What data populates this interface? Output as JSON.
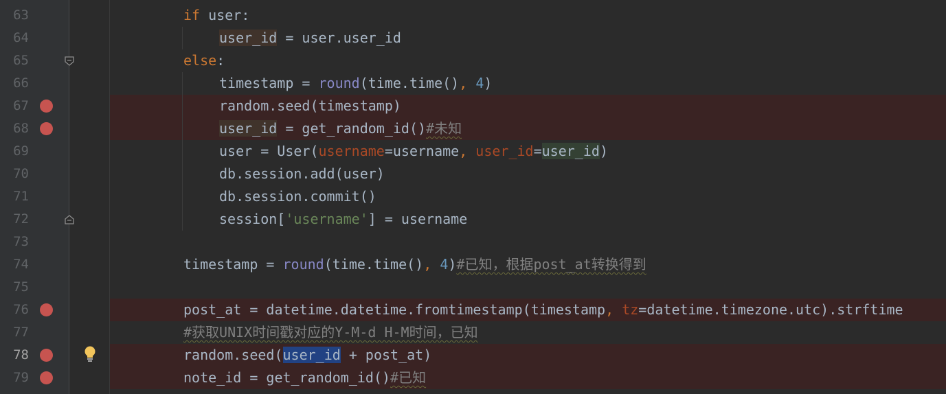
{
  "editor": {
    "lines": [
      {
        "no": "63",
        "tokens": [
          [
            "kw",
            "if"
          ],
          [
            "",
            " "
          ],
          [
            "",
            "user"
          ],
          [
            "",
            ":"
          ]
        ]
      },
      {
        "no": "64",
        "tokens": [
          [
            "hl-write",
            "user_id"
          ],
          [
            "",
            " = user.user_id"
          ]
        ]
      },
      {
        "no": "65",
        "tokens": [
          [
            "kw",
            "else"
          ],
          [
            "",
            ":"
          ]
        ]
      },
      {
        "no": "66",
        "tokens": [
          [
            "",
            "timestamp = "
          ],
          [
            "fn",
            "round"
          ],
          [
            "",
            "(time.time()"
          ],
          [
            "punc",
            ","
          ],
          [
            "",
            " "
          ],
          [
            "num",
            "4"
          ],
          [
            "",
            ")"
          ]
        ]
      },
      {
        "no": "67",
        "tokens": [
          [
            "",
            "random.seed(timestamp)"
          ]
        ]
      },
      {
        "no": "68",
        "tokens": [
          [
            "hl-write",
            "user_id"
          ],
          [
            "",
            " = get_random_id()"
          ],
          [
            "cmt",
            "#未知"
          ]
        ]
      },
      {
        "no": "69",
        "tokens": [
          [
            "",
            "user = User("
          ],
          [
            "param",
            "username"
          ],
          [
            "",
            "=username"
          ],
          [
            "punc",
            ","
          ],
          [
            "",
            " "
          ],
          [
            "param",
            "user_id"
          ],
          [
            "",
            "="
          ],
          [
            "hl-read",
            "user_id"
          ],
          [
            "",
            ")"
          ]
        ]
      },
      {
        "no": "70",
        "tokens": [
          [
            "",
            "db.session.add(user)"
          ]
        ]
      },
      {
        "no": "71",
        "tokens": [
          [
            "",
            "db.session.commit()"
          ]
        ]
      },
      {
        "no": "72",
        "tokens": [
          [
            "",
            "session["
          ],
          [
            "str",
            "'username'"
          ],
          [
            "",
            "] = username"
          ]
        ]
      },
      {
        "no": "73",
        "tokens": []
      },
      {
        "no": "74",
        "tokens": [
          [
            "",
            "timestamp = "
          ],
          [
            "fn",
            "round"
          ],
          [
            "",
            "(time.time()"
          ],
          [
            "punc",
            ","
          ],
          [
            "",
            " "
          ],
          [
            "num",
            "4"
          ],
          [
            "",
            ")"
          ],
          [
            "cmt",
            "#已知，根据post_at转换得到"
          ]
        ]
      },
      {
        "no": "75",
        "tokens": []
      },
      {
        "no": "76",
        "tokens": [
          [
            "",
            "post_at = datetime.datetime.fromtimestamp(timestamp"
          ],
          [
            "punc",
            ","
          ],
          [
            "",
            " "
          ],
          [
            "param",
            "tz"
          ],
          [
            "",
            "=datetime.timezone.utc).strftime"
          ]
        ]
      },
      {
        "no": "77",
        "tokens": [
          [
            "cmt",
            "#获取UNIX时间戳对应的Y-M-d H-M时间，已知"
          ]
        ]
      },
      {
        "no": "78",
        "tokens": [
          [
            "",
            "random.seed("
          ],
          [
            "hl-sel",
            "user_id"
          ],
          [
            "",
            " + post_at)"
          ]
        ]
      },
      {
        "no": "79",
        "tokens": [
          [
            "",
            "note_id = get_random_id()"
          ],
          [
            "cmt",
            "#已知"
          ]
        ]
      }
    ],
    "breakpoint_lines": [
      "67",
      "68",
      "76",
      "78",
      "79"
    ],
    "current_line": "78",
    "intention_bulb_line": "78",
    "fold_start_line": "65",
    "fold_end_line": "72",
    "colors": {
      "background": "#2b2b2b",
      "gutter": "#313335",
      "breakpoint": "#c75450",
      "breakpoint_row": "#3a2323",
      "keyword": "#cc7832",
      "builtin": "#8888c6",
      "number": "#6897bb",
      "string": "#6a8759",
      "named_param": "#aa4926",
      "comment": "#808080",
      "selection": "#214283"
    }
  }
}
